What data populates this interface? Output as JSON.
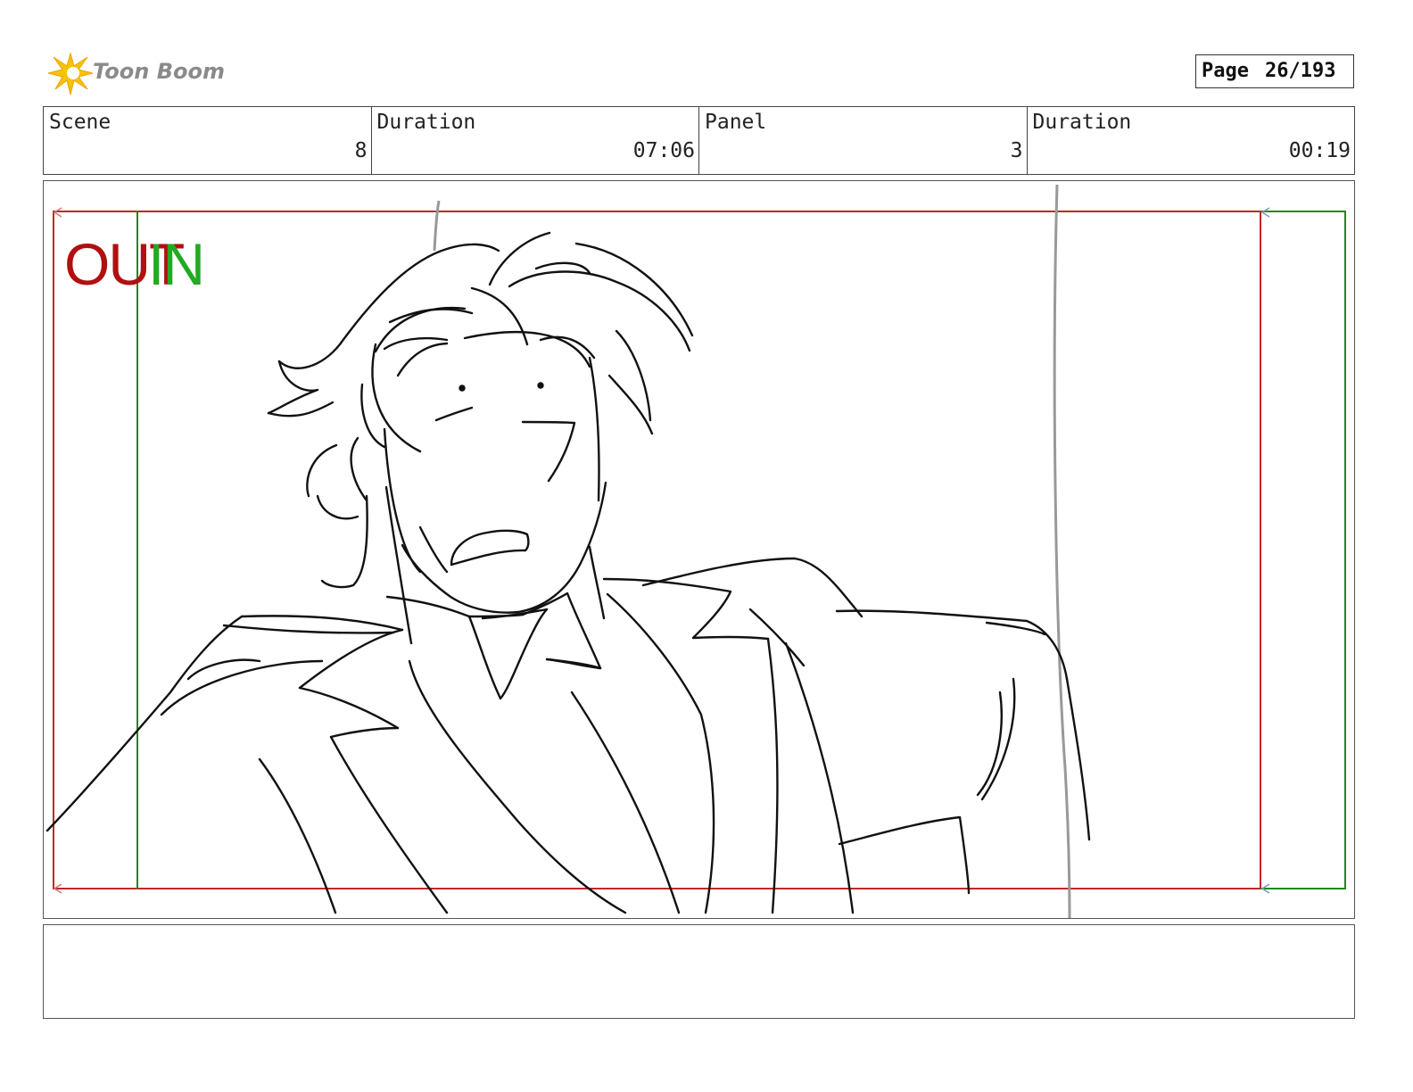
{
  "header": {
    "logo_text": "Toon Boom",
    "page_label": "Page",
    "page_number": "26/193"
  },
  "info": {
    "scene_label": "Scene",
    "scene_value": "8",
    "scene_duration_label": "Duration",
    "scene_duration_value": "07:06",
    "panel_label": "Panel",
    "panel_value": "3",
    "panel_duration_label": "Duration",
    "panel_duration_value": "00:19"
  },
  "frame_labels": {
    "out": "OUT",
    "in": "IN"
  },
  "colors": {
    "out_frame": "#c0282a",
    "in_frame": "#1f8a1f",
    "logo_star": "#f5c400"
  },
  "notes_text": ""
}
